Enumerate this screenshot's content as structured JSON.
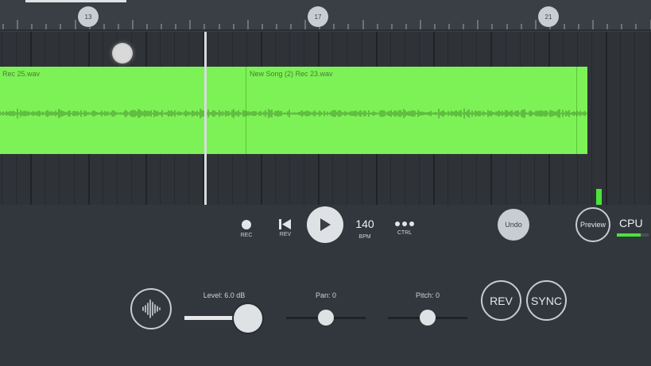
{
  "ruler": {
    "bar_markers": [
      "13",
      "17",
      "21"
    ],
    "progress_fraction": 0.155
  },
  "track": {
    "clips": [
      {
        "name": "Rec 25.wav"
      },
      {
        "name": "New Song (2) Rec 23.wav"
      }
    ],
    "clip_color": "#7df256"
  },
  "transport": {
    "rec_label": "REC",
    "rev_label": "REV",
    "bpm_value": "140",
    "bpm_label": "BPM",
    "ctrl_label": "CTRL",
    "undo_label": "Undo",
    "preview_label": "Preview",
    "cpu_label": "CPU",
    "cpu_level": 0.75
  },
  "controls": {
    "level_label": "Level: 6.0 dB",
    "pan_label": "Pan: 0",
    "pitch_label": "Pitch: 0",
    "rev_button": "REV",
    "sync_button": "SYNC",
    "level_fraction": 0.8,
    "pan_fraction": 0.5,
    "pitch_fraction": 0.5
  },
  "colors": {
    "background": "#32373d",
    "accent_green": "#4be43a",
    "clip_green": "#7df256"
  },
  "icons": [
    "record-icon",
    "rewind-icon",
    "play-icon",
    "more-dots-icon",
    "waveform-icon"
  ]
}
